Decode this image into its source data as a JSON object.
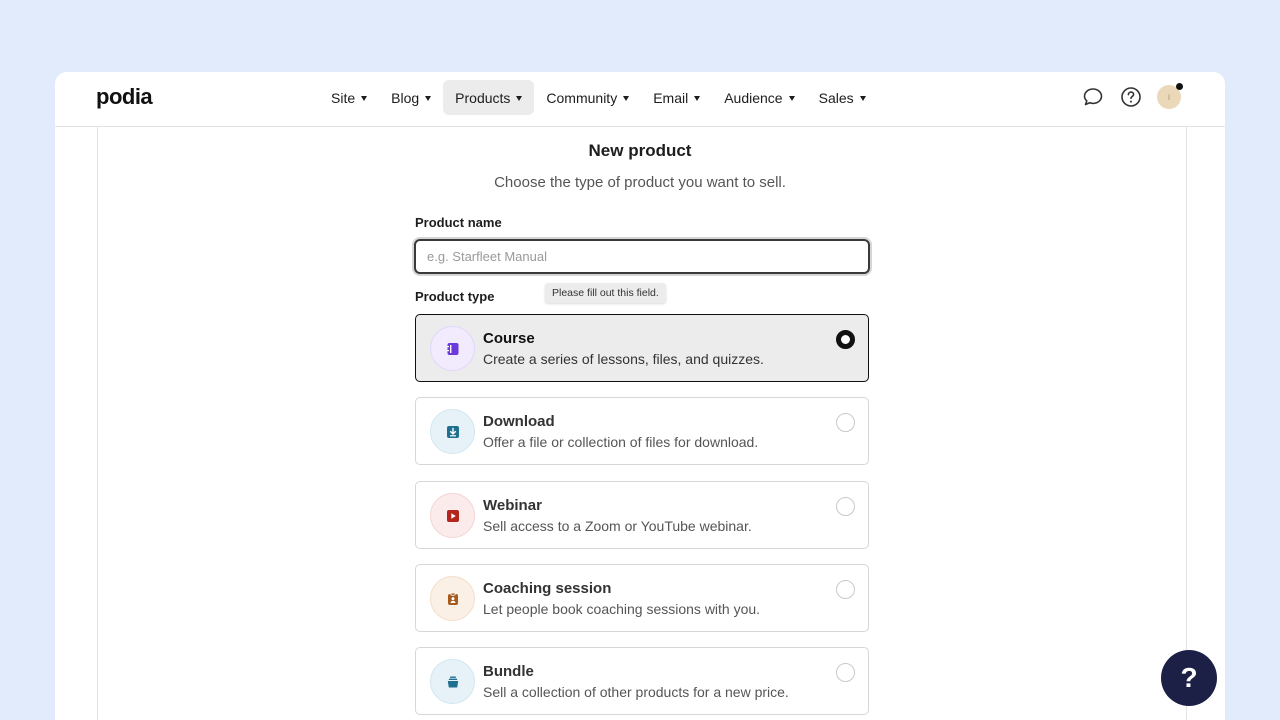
{
  "brand": {
    "logo": "podia"
  },
  "nav": {
    "items": [
      {
        "label": "Site",
        "active": false
      },
      {
        "label": "Blog",
        "active": false
      },
      {
        "label": "Products",
        "active": true
      },
      {
        "label": "Community",
        "active": false
      },
      {
        "label": "Email",
        "active": false
      },
      {
        "label": "Audience",
        "active": false
      },
      {
        "label": "Sales",
        "active": false
      }
    ]
  },
  "top_icons": [
    "chat-bubble-icon",
    "help-circle-icon",
    "avatar"
  ],
  "page": {
    "title": "New product",
    "subtitle": "Choose the type of product you want to sell."
  },
  "form": {
    "name_label": "Product name",
    "name_placeholder": "e.g. Starfleet Manual",
    "name_value": "",
    "validation_tooltip": "Please fill out this field.",
    "type_label": "Product type"
  },
  "product_types": [
    {
      "title": "Course",
      "description": "Create a series of lessons, files, and quizzes.",
      "icon": "notebook-icon",
      "selected": true,
      "color": "#6c3ad8",
      "bg": "#f1ebfd"
    },
    {
      "title": "Download",
      "description": "Offer a file or collection of files for download.",
      "icon": "download-icon",
      "selected": false,
      "color": "#1f6f8f",
      "bg": "#e7f2f8"
    },
    {
      "title": "Webinar",
      "description": "Sell access to a Zoom or YouTube webinar.",
      "icon": "play-icon",
      "selected": false,
      "color": "#b3261e",
      "bg": "#fbeceb"
    },
    {
      "title": "Coaching session",
      "description": "Let people book coaching sessions with you.",
      "icon": "clipboard-person-icon",
      "selected": false,
      "color": "#a65a1c",
      "bg": "#fbf0e6"
    },
    {
      "title": "Bundle",
      "description": "Sell a collection of other products for a new price.",
      "icon": "stack-icon",
      "selected": false,
      "color": "#1f6f8f",
      "bg": "#e7f2f8"
    }
  ],
  "help_button": {
    "label": "?"
  }
}
